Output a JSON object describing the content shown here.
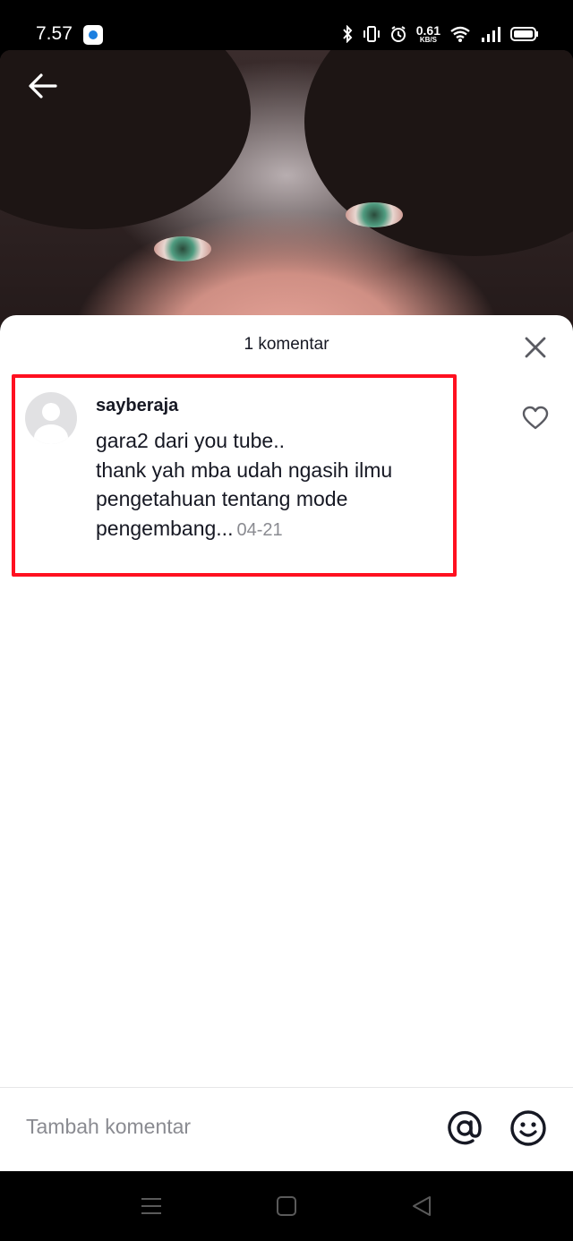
{
  "status_bar": {
    "time": "7.57",
    "net_speed_value": "0.61",
    "net_speed_unit": "KB/S"
  },
  "sheet": {
    "title": "1 komentar"
  },
  "comment": {
    "username": "sayberaja",
    "text": "gara2 dari you tube..\nthank yah mba udah ngasih ilmu\npengetahuan tentang mode\npengembang...",
    "date": "04-21"
  },
  "input": {
    "placeholder": "Tambah komentar"
  },
  "icons": {
    "back": "back-arrow-icon",
    "close": "close-icon",
    "like": "heart-outline-icon",
    "mention": "at-mention-icon",
    "emoji": "emoji-icon"
  },
  "colors": {
    "highlight_border": "#ff1020",
    "text_primary": "#161823",
    "text_secondary": "#8a8b91"
  }
}
